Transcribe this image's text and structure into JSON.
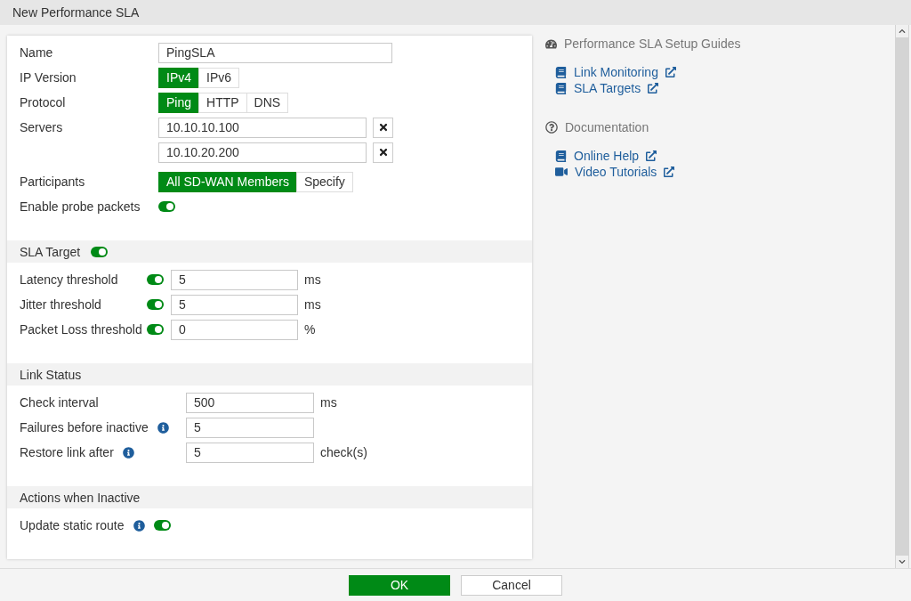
{
  "window": {
    "title": "New Performance SLA"
  },
  "general_rows": [
    {
      "kind": "text",
      "label": "Name",
      "value": "PingSLA"
    },
    {
      "kind": "segmented",
      "label": "IP Version",
      "options": [
        {
          "label": "IPv4",
          "selected": true
        },
        {
          "label": "IPv6",
          "selected": false
        }
      ]
    },
    {
      "kind": "segmented",
      "label": "Protocol",
      "options": [
        {
          "label": "Ping",
          "selected": true
        },
        {
          "label": "HTTP",
          "selected": false
        },
        {
          "label": "DNS",
          "selected": false
        }
      ]
    },
    {
      "kind": "servers",
      "label": "Servers",
      "values": [
        "10.10.10.100",
        "10.10.20.200"
      ]
    },
    {
      "kind": "segmented",
      "label": "Participants",
      "options": [
        {
          "label": "All SD-WAN Members",
          "selected": true
        },
        {
          "label": "Specify",
          "selected": false
        }
      ]
    },
    {
      "kind": "toggle",
      "label": "Enable probe packets",
      "on": true
    }
  ],
  "sections": [
    {
      "title": "SLA Target",
      "on": true,
      "rows": [
        {
          "kind": "threshold",
          "label": "Latency threshold",
          "on": true,
          "value": "5",
          "unit": "ms"
        },
        {
          "kind": "threshold",
          "label": "Jitter threshold",
          "on": true,
          "value": "5",
          "unit": "ms"
        },
        {
          "kind": "threshold",
          "label": "Packet Loss threshold",
          "on": true,
          "value": "0",
          "unit": "%"
        }
      ]
    },
    {
      "title": "Link Status",
      "rows": [
        {
          "kind": "field",
          "label": "Check interval",
          "info": false,
          "value": "500",
          "unit": "ms"
        },
        {
          "kind": "field",
          "label": "Failures before inactive",
          "info": true,
          "value": "5"
        },
        {
          "kind": "field",
          "label": "Restore link after",
          "info": true,
          "value": "5",
          "unit": "check(s)"
        }
      ]
    },
    {
      "title": "Actions when Inactive",
      "rows": [
        {
          "kind": "toggle",
          "label": "Update static route",
          "info": true,
          "on": true
        }
      ]
    }
  ],
  "side_panel": [
    {
      "title": "Performance SLA Setup Guides",
      "kind": "guides",
      "links": [
        {
          "label": "Link Monitoring",
          "kind": "guide"
        },
        {
          "label": "SLA Targets",
          "kind": "guide"
        }
      ]
    },
    {
      "title": "Documentation",
      "kind": "docs",
      "links": [
        {
          "label": "Online Help",
          "kind": "guide"
        },
        {
          "label": "Video Tutorials",
          "kind": "video"
        }
      ]
    }
  ],
  "buttons": [
    {
      "label": "OK",
      "kind": "primary"
    },
    {
      "label": "Cancel",
      "kind": "secondary"
    }
  ]
}
